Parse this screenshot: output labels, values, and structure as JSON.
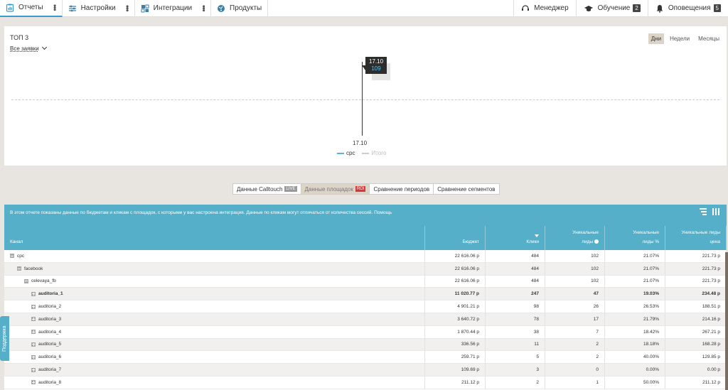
{
  "nav": {
    "left": [
      {
        "label": "Отчеты",
        "icon": "report-icon"
      },
      {
        "label": "Настройки",
        "icon": "settings-sliders-icon"
      },
      {
        "label": "Интеграции",
        "icon": "integrations-icon"
      },
      {
        "label": "Продукты",
        "icon": "products-icon"
      }
    ],
    "manager": "Менеджер",
    "learning": "Обучение",
    "learning_count": "2",
    "notifications": "Оповещения",
    "notifications_count": "5"
  },
  "chart": {
    "title": "ТОП 3",
    "filter": "Все заявки",
    "periods": [
      "Дни",
      "Недели",
      "Месяцы"
    ],
    "tooltip_date": "17.10",
    "tooltip_value": "109",
    "x_label": "17.10",
    "legend": [
      "cpc",
      "Итого"
    ],
    "colors": {
      "cpc": "#5bb3d9",
      "total": "#cccccc"
    }
  },
  "chart_data": {
    "type": "bar",
    "categories": [
      "17.10"
    ],
    "series": [
      {
        "name": "cpc",
        "values": [
          109
        ]
      }
    ]
  },
  "tabs": {
    "t1": "Данные Calltouch",
    "t1_tag": "LIVE",
    "t2": "Данные площадок",
    "t2_tag": "ROI",
    "t3": "Сравнение периодов",
    "t4": "Сравнение сегментов"
  },
  "table": {
    "info": "В этом отчете показаны данные по бюджетам и кликам с площадок, с которыми у вас настроена интеграция. Данные по кликам могут отличаться от количества сессий. Помощь",
    "headers": {
      "channel": "Канал",
      "budget": "Бюджет",
      "clicks": "Клики",
      "unique_leads_1": "Уникальные",
      "unique_leads_2": "лиды",
      "unique_pct_1": "Уникальные",
      "unique_pct_2": "лиды %",
      "unique_price_1": "Уникальные лиды",
      "unique_price_2": "цена"
    },
    "rows": [
      {
        "name": "cpc",
        "budget": "22 616.06 р",
        "clicks": "484",
        "leads": "102",
        "pct": "21.07%",
        "price": "221.73 р"
      },
      {
        "name": "facebook",
        "budget": "22 616.06 р",
        "clicks": "484",
        "leads": "102",
        "pct": "21.07%",
        "price": "221.73 р"
      },
      {
        "name": "celevaya_fb",
        "budget": "22 616.06 р",
        "clicks": "484",
        "leads": "102",
        "pct": "21.07%",
        "price": "221.73 р"
      },
      {
        "name": "auditoria_1",
        "budget": "11 020.77 р",
        "clicks": "247",
        "leads": "47",
        "pct": "19.03%",
        "price": "234.48 р"
      },
      {
        "name": "auditoria_2",
        "budget": "4 901.21 р",
        "clicks": "98",
        "leads": "26",
        "pct": "26.53%",
        "price": "188.51 р"
      },
      {
        "name": "auditoria_3",
        "budget": "3 640.72 р",
        "clicks": "78",
        "leads": "17",
        "pct": "21.79%",
        "price": "214.16 р"
      },
      {
        "name": "auditoria_4",
        "budget": "1 870.44 р",
        "clicks": "38",
        "leads": "7",
        "pct": "18.42%",
        "price": "267.21 р"
      },
      {
        "name": "auditoria_5",
        "budget": "336.56 р",
        "clicks": "11",
        "leads": "2",
        "pct": "18.18%",
        "price": "168.28 р"
      },
      {
        "name": "auditoria_6",
        "budget": "259.71 р",
        "clicks": "5",
        "leads": "2",
        "pct": "40.00%",
        "price": "129.85 р"
      },
      {
        "name": "auditoria_7",
        "budget": "109.69 р",
        "clicks": "3",
        "leads": "0",
        "pct": "0.00%",
        "price": "0.00 р"
      },
      {
        "name": "auditoria_8",
        "budget": "211.12 р",
        "clicks": "2",
        "leads": "1",
        "pct": "50.00%",
        "price": "211.12 р"
      }
    ]
  },
  "support": "Поддержка"
}
